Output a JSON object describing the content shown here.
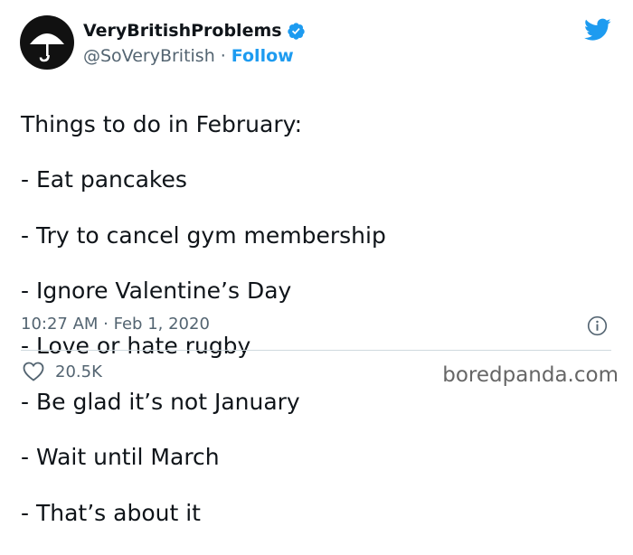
{
  "author": {
    "display_name": "VeryBritishProblems",
    "handle": "@SoVeryBritish",
    "separator": "·",
    "follow_label": "Follow",
    "verified": true,
    "avatar_icon": "umbrella-icon"
  },
  "tweet": {
    "lines": [
      "Things to do in February:",
      "- Eat pancakes",
      "- Try to cancel gym membership",
      "- Ignore Valentine’s Day",
      "- Love or hate rugby",
      "- Be glad it’s not January",
      "- Wait until March",
      "- That’s about it"
    ],
    "timestamp": "10:27 AM · Feb 1, 2020",
    "like_count": "20.5K"
  },
  "watermark": "boredpanda.com",
  "colors": {
    "accent": "#1d9bf0",
    "text": "#0f1419",
    "secondary": "#536471",
    "divider": "#cfd9de"
  }
}
